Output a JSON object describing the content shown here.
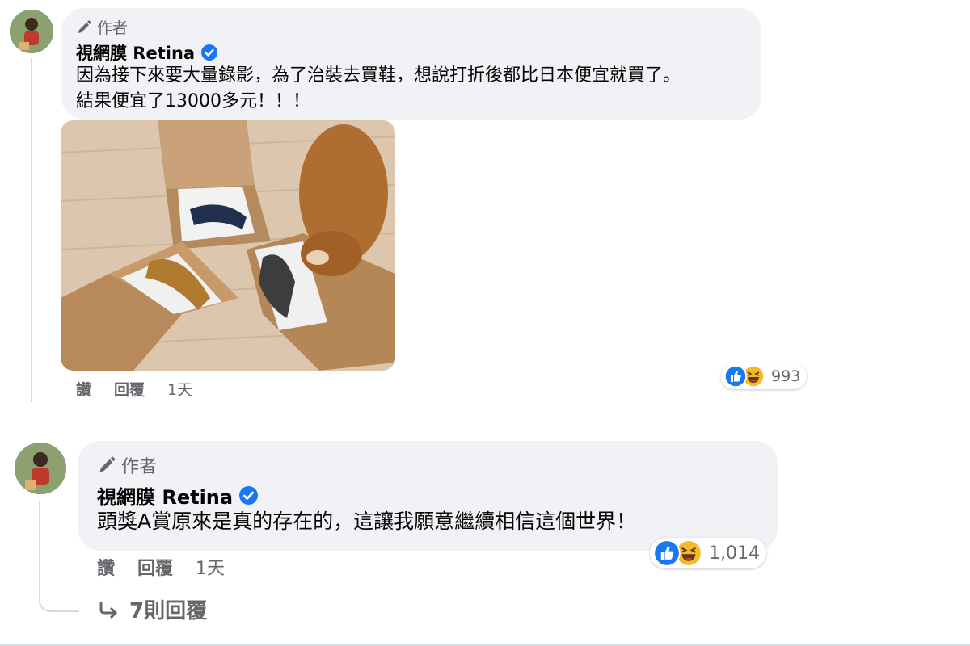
{
  "comments": [
    {
      "author_tag": "作者",
      "name": "視網膜 Retina",
      "text": "因為接下來要大量錄影，為了治裝去買鞋，想說打折後都比日本便宜就買了。\n結果便宜了13000多元！！！",
      "actions": {
        "like": "讚",
        "reply": "回覆",
        "time": "1天"
      },
      "reaction_count": "993",
      "photo_icon": "shoe-boxes-with-shiba-dog-photo"
    },
    {
      "author_tag": "作者",
      "name": "視網膜 Retina",
      "text": "頭獎A賞原來是真的存在的，這讓我願意繼續相信這個世界！",
      "actions": {
        "like": "讚",
        "reply": "回覆",
        "time": "1天"
      },
      "reaction_count": "1,014",
      "replies_link": "7則回覆"
    }
  ],
  "colors": {
    "bubble": "#f0f2f5",
    "secondary_text": "#65676b",
    "verified_blue": "#1877f2",
    "like_blue": "#1877f2",
    "haha_yellow": "#f7b928"
  },
  "icons": [
    "pencil-icon",
    "verified-badge-icon",
    "like-reaction-icon",
    "haha-reaction-icon",
    "reply-arrow-icon"
  ]
}
